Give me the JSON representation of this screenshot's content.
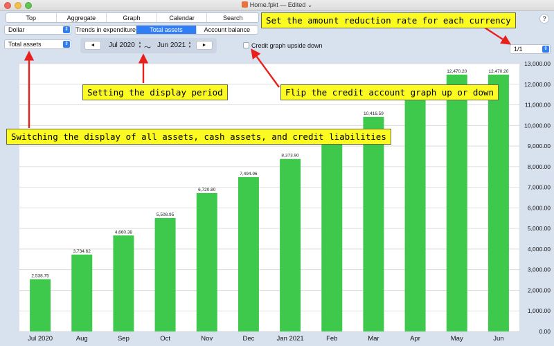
{
  "window": {
    "title": "Home.fpkt — Edited ⌄"
  },
  "nav_tabs": [
    "Top",
    "Aggregate",
    "Graph",
    "Calendar",
    "Search"
  ],
  "currency_select": {
    "value": "Dollar"
  },
  "view_tabs": {
    "items": [
      "Trends in expenditure",
      "Total assets",
      "Account balance"
    ],
    "active": 1
  },
  "asset_select": {
    "value": "Total assets"
  },
  "period": {
    "prev_label": "◄",
    "next_label": "►",
    "from": "Jul 2020",
    "separator": "～",
    "to": "Jun 2021"
  },
  "credit_toggle": {
    "label": "Credit graph upside down",
    "checked": false
  },
  "rate_select": {
    "value": "1/1"
  },
  "help_label": "?",
  "callouts": {
    "currency_rate": "Set the amount reduction rate for each currency",
    "display_period": "Setting the display period",
    "credit_flip": "Flip the credit account graph up or down",
    "asset_switch": "Switching the display of all assets, cash assets, and credit liabilities"
  },
  "colors": {
    "bar": "#3ec94c",
    "accent": "#2f7ef6",
    "callout_bg": "#fbfb22",
    "arrow": "#e8201c",
    "plot_bg": "#ffffff"
  },
  "chart_data": {
    "type": "bar",
    "categories": [
      "Jul 2020",
      "Aug",
      "Sep",
      "Oct",
      "Nov",
      "Dec",
      "Jan 2021",
      "Feb",
      "Mar",
      "Apr",
      "May",
      "Jun"
    ],
    "values": [
      2538.75,
      3734.62,
      4660.38,
      5508.95,
      6720.8,
      7494.96,
      8373.9,
      9320,
      10416.59,
      11450,
      12470.2,
      12470.2
    ],
    "data_labels": [
      "2,538.75",
      "3,734.62",
      "4,660.38",
      "5,508.95",
      "6,720.80",
      "7,494.96",
      "8,373.90",
      "",
      "10,416.59",
      "",
      "12,470.20",
      "12,470.20"
    ],
    "ylim": [
      0,
      13000
    ],
    "yticks": [
      0,
      1000,
      2000,
      3000,
      4000,
      5000,
      6000,
      7000,
      8000,
      9000,
      10000,
      11000,
      12000,
      13000
    ],
    "ytick_labels": [
      "0.00",
      "1,000.00",
      "2,000.00",
      "3,000.00",
      "4,000.00",
      "5,000.00",
      "6,000.00",
      "7,000.00",
      "8,000.00",
      "9,000.00",
      "10,000.00",
      "11,000.00",
      "12,000.00",
      "13,000.00"
    ],
    "grid": true,
    "y_axis_side": "right"
  }
}
